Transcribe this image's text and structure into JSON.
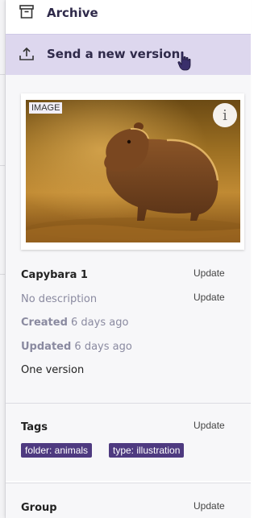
{
  "menu": {
    "archive_label": "Archive",
    "send_version_label": "Send a new version"
  },
  "media": {
    "badge": "IMAGE",
    "info_glyph": "i",
    "title": "Capybara 1",
    "description": "No description",
    "created_label": "Created",
    "created_value": "6 days ago",
    "updated_label": "Updated",
    "updated_value": "6 days ago",
    "versions": "One version",
    "update_label": "Update"
  },
  "tags": {
    "title": "Tags",
    "update_label": "Update",
    "items": [
      "folder: animals",
      "type: illustration"
    ]
  },
  "group": {
    "title": "Group",
    "update_label": "Update"
  },
  "colors": {
    "accent": "#4e3a80",
    "highlight": "#ddd7ee"
  }
}
